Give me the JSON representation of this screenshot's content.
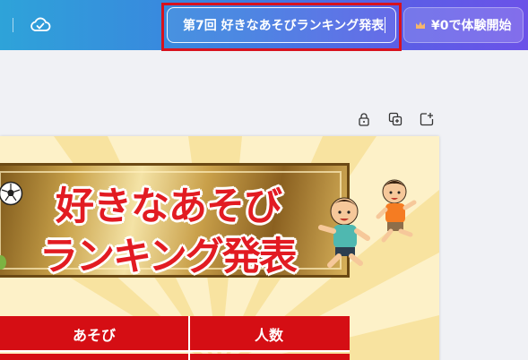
{
  "toolbar": {
    "project_title": "第7回 好きなあそびランキング発表",
    "trial_label": "¥0で体験開始"
  },
  "icons": [
    "cloud-check-icon",
    "crown-icon",
    "lock-icon",
    "duplicate-icon",
    "add-page-icon"
  ],
  "design": {
    "headline_line1": "好きなあそび",
    "headline_line2": "ランキング発表",
    "table_headers": [
      "あそび",
      "人数"
    ]
  },
  "colors": {
    "header_gradient_start": "#2ea3d9",
    "header_gradient_end": "#6b52e8",
    "highlight_frame": "#d8121e",
    "headline_red": "#e21b22",
    "table_red": "#d50e14",
    "page_background": "#fdf1c8"
  }
}
